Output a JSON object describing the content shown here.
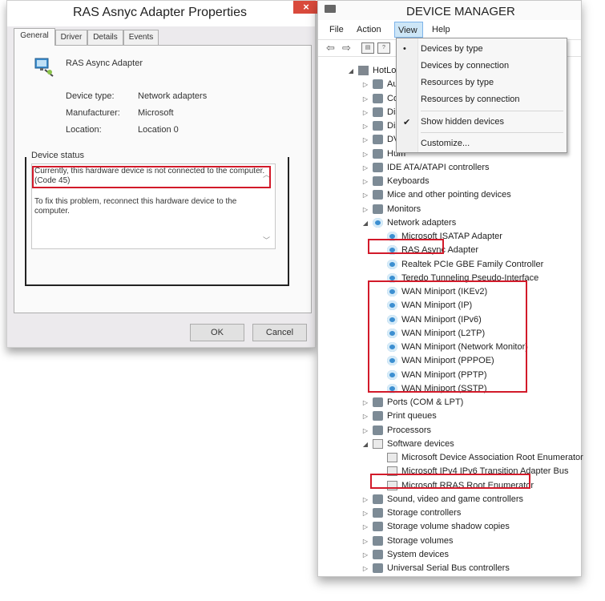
{
  "dialog": {
    "title": "RAS Asnyc Adapter Properties",
    "close_label": "×",
    "tabs": [
      "General",
      "Driver",
      "Details",
      "Events"
    ],
    "device_name": "RAS Async Adapter",
    "properties": [
      {
        "label": "Device type:",
        "value": "Network adapters"
      },
      {
        "label": "Manufacturer:",
        "value": "Microsoft"
      },
      {
        "label": "Location:",
        "value": "Location 0"
      }
    ],
    "status_legend": "Device status",
    "status_line1": "Currently, this hardware device is not connected to the computer. (Code 45)",
    "status_line2": "To fix this problem, reconnect this hardware device to the computer.",
    "ok_label": "OK",
    "cancel_label": "Cancel"
  },
  "device_manager": {
    "title": "DEVICE MANAGER",
    "menu": [
      "File",
      "Action",
      "View",
      "Help"
    ],
    "view_menu": {
      "items": [
        {
          "label": "Devices by type",
          "mark": "•"
        },
        {
          "label": "Devices by connection",
          "mark": ""
        },
        {
          "label": "Resources by type",
          "mark": ""
        },
        {
          "label": "Resources by connection",
          "mark": ""
        },
        {
          "label": "Show hidden devices",
          "mark": "✔"
        },
        {
          "label": "Customize...",
          "mark": ""
        }
      ]
    },
    "tree": [
      {
        "label": "HotLoad",
        "level": 0,
        "expander": "◢",
        "icon": "root"
      },
      {
        "label": "Audio",
        "level": 1,
        "expander": "▷",
        "icon": "cat"
      },
      {
        "label": "Comp",
        "level": 1,
        "expander": "▷",
        "icon": "cat"
      },
      {
        "label": "Disk d",
        "level": 1,
        "expander": "▷",
        "icon": "cat"
      },
      {
        "label": "Displa",
        "level": 1,
        "expander": "▷",
        "icon": "cat"
      },
      {
        "label": "DVD/",
        "level": 1,
        "expander": "▷",
        "icon": "cat"
      },
      {
        "label": "Hum",
        "level": 1,
        "expander": "▷",
        "icon": "cat"
      },
      {
        "label": "IDE ATA/ATAPI controllers",
        "level": 1,
        "expander": "▷",
        "icon": "cat"
      },
      {
        "label": "Keyboards",
        "level": 1,
        "expander": "▷",
        "icon": "cat"
      },
      {
        "label": "Mice and other pointing devices",
        "level": 1,
        "expander": "▷",
        "icon": "cat"
      },
      {
        "label": "Monitors",
        "level": 1,
        "expander": "▷",
        "icon": "cat"
      },
      {
        "label": "Network adapters",
        "level": 1,
        "expander": "◢",
        "icon": "net"
      },
      {
        "label": "Microsoft ISATAP Adapter",
        "level": 2,
        "expander": "",
        "icon": "net"
      },
      {
        "label": "RAS Async Adapter",
        "level": 2,
        "expander": "",
        "icon": "net"
      },
      {
        "label": "Realtek PCIe GBE Family Controller",
        "level": 2,
        "expander": "",
        "icon": "net"
      },
      {
        "label": "Teredo Tunneling Pseudo-Interface",
        "level": 2,
        "expander": "",
        "icon": "net"
      },
      {
        "label": "WAN Miniport (IKEv2)",
        "level": 2,
        "expander": "",
        "icon": "net"
      },
      {
        "label": "WAN Miniport (IP)",
        "level": 2,
        "expander": "",
        "icon": "net"
      },
      {
        "label": "WAN Miniport (IPv6)",
        "level": 2,
        "expander": "",
        "icon": "net"
      },
      {
        "label": "WAN Miniport (L2TP)",
        "level": 2,
        "expander": "",
        "icon": "net"
      },
      {
        "label": "WAN Miniport (Network Monitor)",
        "level": 2,
        "expander": "",
        "icon": "net"
      },
      {
        "label": "WAN Miniport (PPPOE)",
        "level": 2,
        "expander": "",
        "icon": "net"
      },
      {
        "label": "WAN Miniport (PPTP)",
        "level": 2,
        "expander": "",
        "icon": "net"
      },
      {
        "label": "WAN Miniport (SSTP)",
        "level": 2,
        "expander": "",
        "icon": "net"
      },
      {
        "label": "Ports (COM & LPT)",
        "level": 1,
        "expander": "▷",
        "icon": "cat"
      },
      {
        "label": "Print queues",
        "level": 1,
        "expander": "▷",
        "icon": "cat"
      },
      {
        "label": "Processors",
        "level": 1,
        "expander": "▷",
        "icon": "cat"
      },
      {
        "label": "Software devices",
        "level": 1,
        "expander": "◢",
        "icon": "sys"
      },
      {
        "label": "Microsoft Device Association Root Enumerator",
        "level": 2,
        "expander": "",
        "icon": "sys"
      },
      {
        "label": "Microsoft IPv4 IPv6 Transition Adapter Bus",
        "level": 2,
        "expander": "",
        "icon": "sys"
      },
      {
        "label": "Microsoft RRAS Root Enumerator",
        "level": 2,
        "expander": "",
        "icon": "sys"
      },
      {
        "label": "Sound, video and game controllers",
        "level": 1,
        "expander": "▷",
        "icon": "cat"
      },
      {
        "label": "Storage controllers",
        "level": 1,
        "expander": "▷",
        "icon": "cat"
      },
      {
        "label": "Storage volume shadow copies",
        "level": 1,
        "expander": "▷",
        "icon": "cat"
      },
      {
        "label": "Storage volumes",
        "level": 1,
        "expander": "▷",
        "icon": "cat"
      },
      {
        "label": "System devices",
        "level": 1,
        "expander": "▷",
        "icon": "cat"
      },
      {
        "label": "Universal Serial Bus controllers",
        "level": 1,
        "expander": "▷",
        "icon": "cat"
      }
    ]
  },
  "colors": {
    "highlight_red": "#d21a2a",
    "close_red": "#d94a3c",
    "menu_open_blue": "#cde6f7"
  }
}
